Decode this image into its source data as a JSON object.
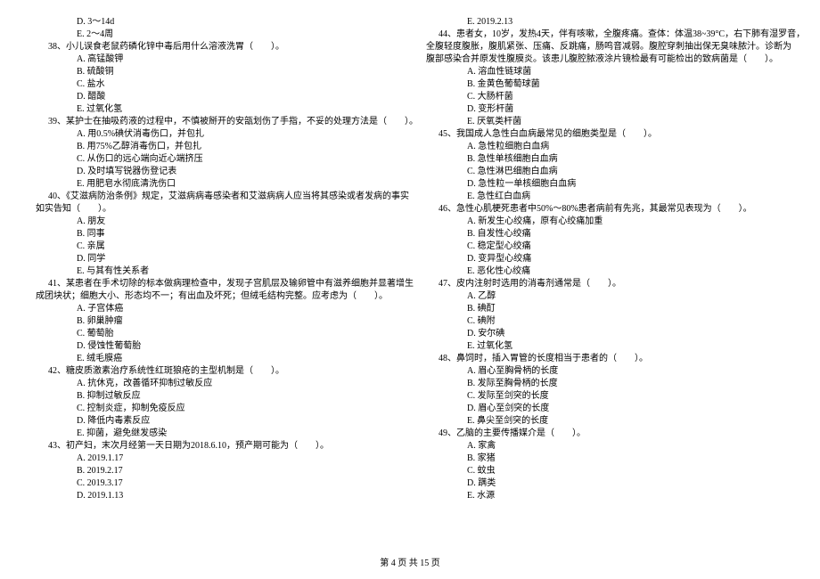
{
  "footer": "第 4 页 共 15 页",
  "left": {
    "pre_opts": [
      "D. 3～14d",
      "E. 2～4周"
    ],
    "questions": [
      {
        "num": "38、",
        "text": "小儿误食老鼠药磷化锌中毒后用什么溶液洗胃（　　）。",
        "opts": [
          "A. 高锰酸钾",
          "B. 硫酸铜",
          "C. 盐水",
          "D. 醋酸",
          "E. 过氧化氢"
        ]
      },
      {
        "num": "39、",
        "text": "某护士在抽吸药液的过程中，不慎被掰开的安瓿划伤了手指，不妥的处理方法是（　　）。",
        "opts": [
          "A. 用0.5%碘伏消毒伤口，并包扎",
          "B. 用75%乙醇消毒伤口，并包扎",
          "C. 从伤口的远心端向近心端挤压",
          "D. 及时填写锐器伤登记表",
          "E. 用肥皂水彻底清洗伤口"
        ]
      },
      {
        "num": "40、",
        "text": "《艾滋病防治条例》规定，艾滋病病毒感染者和艾滋病病人应当将其感染或者发病的事实",
        "cont": "如实告知（　　）。",
        "opts": [
          "A. 朋友",
          "B. 同事",
          "C. 亲属",
          "D. 同学",
          "E. 与其有性关系者"
        ]
      },
      {
        "num": "41、",
        "text": "某患者在手术切除的标本做病理检查中，发现子宫肌层及输卵管中有滋养细胞并显著增生",
        "cont": "成团块状；细胞大小、形态均不一；有出血及坏死；但绒毛结构完整。应考虑为（　　）。",
        "opts": [
          "A. 子宫体癌",
          "B. 卵巢肿瘤",
          "C. 葡萄胎",
          "D. 侵蚀性葡萄胎",
          "E. 绒毛膜癌"
        ]
      },
      {
        "num": "42、",
        "text": "糖皮质激素治疗系统性红斑狼疮的主型机制是（　　）。",
        "opts": [
          "A. 抗休克，改善循环抑制过敏反应",
          "B. 抑制过敏反应",
          "C. 控制炎症，抑制免疫反应",
          "D. 降低内毒素反应",
          "E. 抑菌，避免继发感染"
        ]
      },
      {
        "num": "43、",
        "text": "初产妇，末次月经第一天日期为2018.6.10，预产期可能为（　　）。",
        "opts": [
          "A. 2019.1.17",
          "B. 2019.2.17",
          "C. 2019.3.17",
          "D. 2019.1.13"
        ]
      }
    ]
  },
  "right": {
    "pre_opts": [
      "E. 2019.2.13"
    ],
    "questions": [
      {
        "num": "44、",
        "text": "患者女，10岁，发热4天，伴有咳嗽，全腹疼痛。查体：体温38~39°C，右下肺有湿罗音，",
        "cont": "全腹轻度腹胀，腹肌紧张、压痛、反跳痛，肠鸣音减弱。腹腔穿刺抽出保无臭味脓汁。诊断为",
        "cont2": "腹部感染合并原发性腹膜炎。该患儿腹腔脓液涂片镜检最有可能检出的致病菌是（　　）。",
        "opts": [
          "A. 溶血性链球菌",
          "B. 金黄色葡萄球菌",
          "C. 大肠杆菌",
          "D. 变形杆菌",
          "E. 厌氧类杆菌"
        ]
      },
      {
        "num": "45、",
        "text": "我国成人急性白血病最常见的细胞类型是（　　）。",
        "opts": [
          "A. 急性粒细胞白血病",
          "B. 急性单核细胞白血病",
          "C. 急性淋巴细胞白血病",
          "D. 急性粒一单核细胞白血病",
          "E. 急性红白血病"
        ]
      },
      {
        "num": "46、",
        "text": "急性心肌梗死患者中50%～80%患者病前有先兆，其最常见表现为（　　）。",
        "opts": [
          "A. 新发生心绞痛，原有心绞痛加重",
          "B. 自发性心绞痛",
          "C. 稳定型心绞痛",
          "D. 变异型心绞痛",
          "E. 恶化性心绞痛"
        ]
      },
      {
        "num": "47、",
        "text": "皮内注射时选用的消毒剂通常是（　　）。",
        "opts": [
          "A. 乙醇",
          "B. 碘酊",
          "C. 碘附",
          "D. 安尔碘",
          "E. 过氧化氢"
        ]
      },
      {
        "num": "48、",
        "text": "鼻饲时，插入胃管的长度相当于患者的（　　）。",
        "opts": [
          "A. 眉心至胸骨柄的长度",
          "B. 发际至胸骨柄的长度",
          "C. 发际至剑突的长度",
          "D. 眉心至剑突的长度",
          "E. 鼻尖至剑突的长度"
        ]
      },
      {
        "num": "49、",
        "text": "乙脑的主要传播媒介是（　　）。",
        "opts": [
          "A. 家禽",
          "B. 家猪",
          "C. 蚊虫",
          "D. 蹒类",
          "E. 水源"
        ]
      }
    ]
  }
}
